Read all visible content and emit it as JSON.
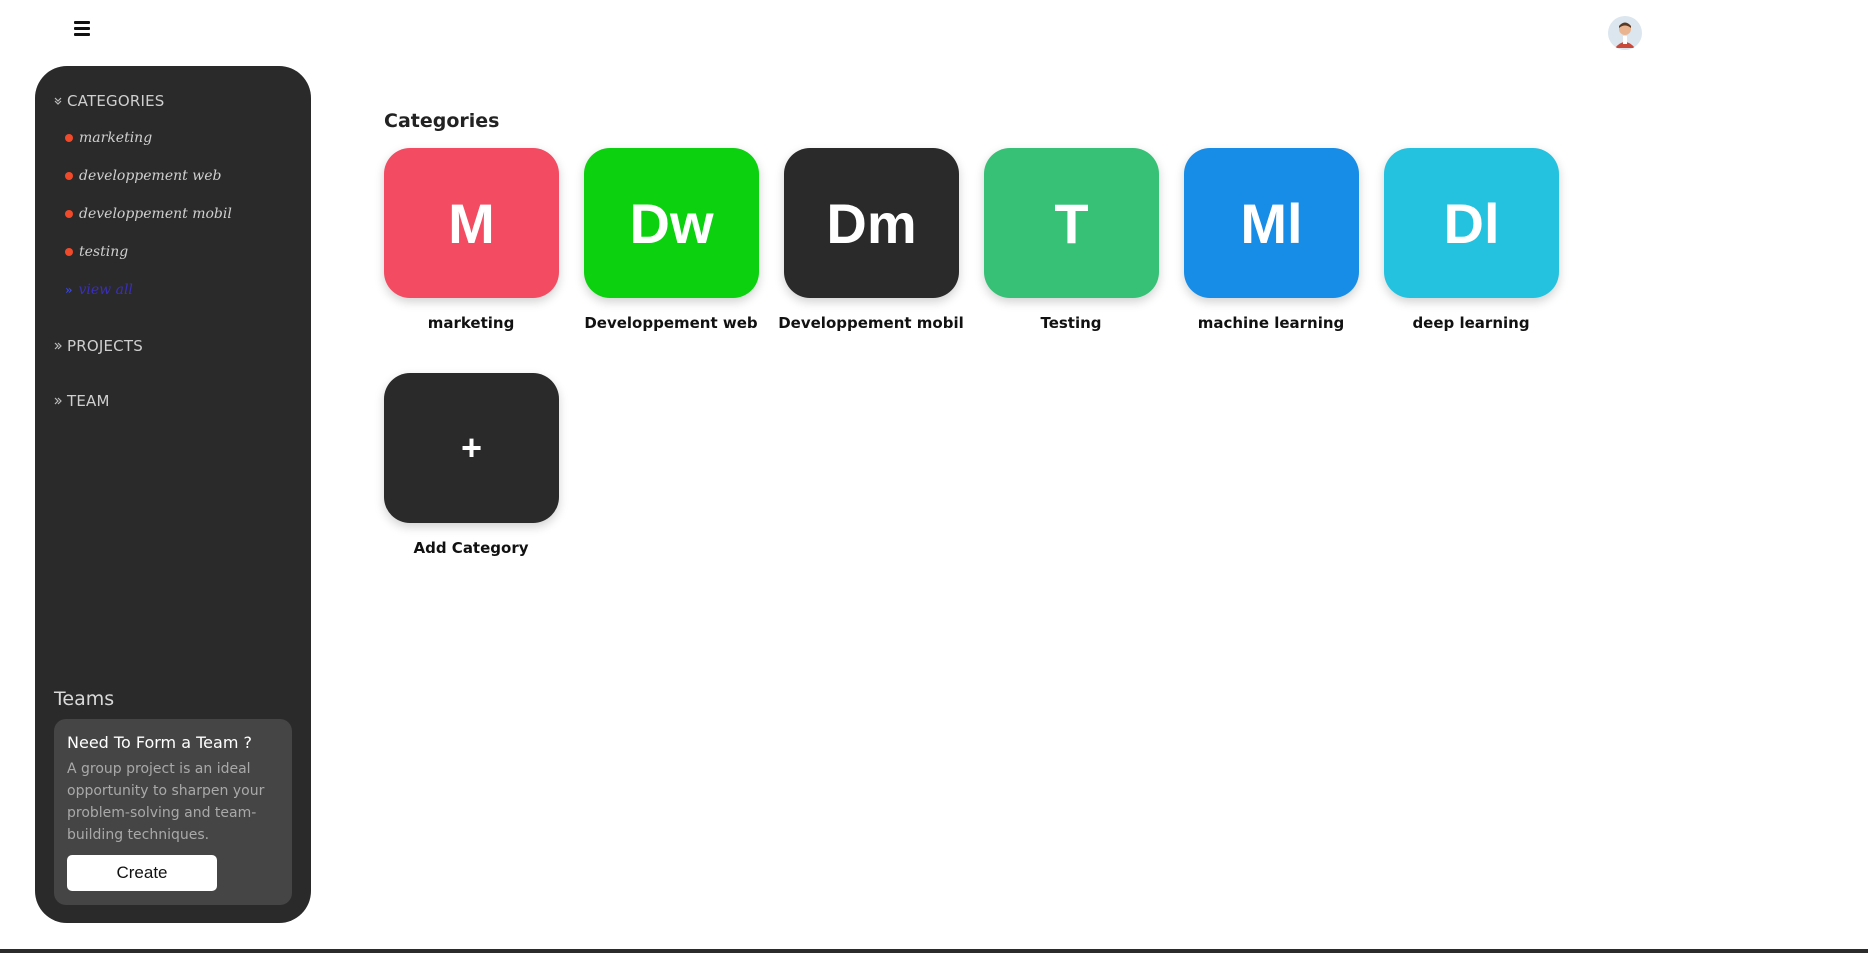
{
  "header": {
    "menu_icon": "hamburger-icon",
    "avatar_icon": "user-avatar"
  },
  "sidebar": {
    "categories_label": "CATEGORIES",
    "category_items": [
      {
        "label": "marketing"
      },
      {
        "label": "developpement web"
      },
      {
        "label": "developpement mobil"
      },
      {
        "label": "testing"
      }
    ],
    "see_all_label": "view all",
    "projects_label": "PROJECTS",
    "team_label": "TEAM",
    "teams": {
      "title": "Teams",
      "card_title": "Need To Form a Team ?",
      "card_text": "A group project is an ideal opportunity to sharpen your problem-solving and team-building techniques.",
      "button_label": "Create"
    }
  },
  "main": {
    "title": "Categories",
    "categories": [
      {
        "abbr": "M",
        "name": "marketing",
        "color": "#f24b62"
      },
      {
        "abbr": "Dw",
        "name": "Developpement web",
        "color": "#0bd10f"
      },
      {
        "abbr": "Dm",
        "name": "Developpement mobil",
        "color": "#2a2a2a"
      },
      {
        "abbr": "T",
        "name": "Testing",
        "color": "#36c176"
      },
      {
        "abbr": "Ml",
        "name": "machine learning",
        "color": "#178de8"
      },
      {
        "abbr": "Dl",
        "name": "deep learning",
        "color": "#25c2e0"
      }
    ],
    "add": {
      "symbol": "+",
      "label": "Add Category",
      "color": "#2a2a2a"
    }
  }
}
